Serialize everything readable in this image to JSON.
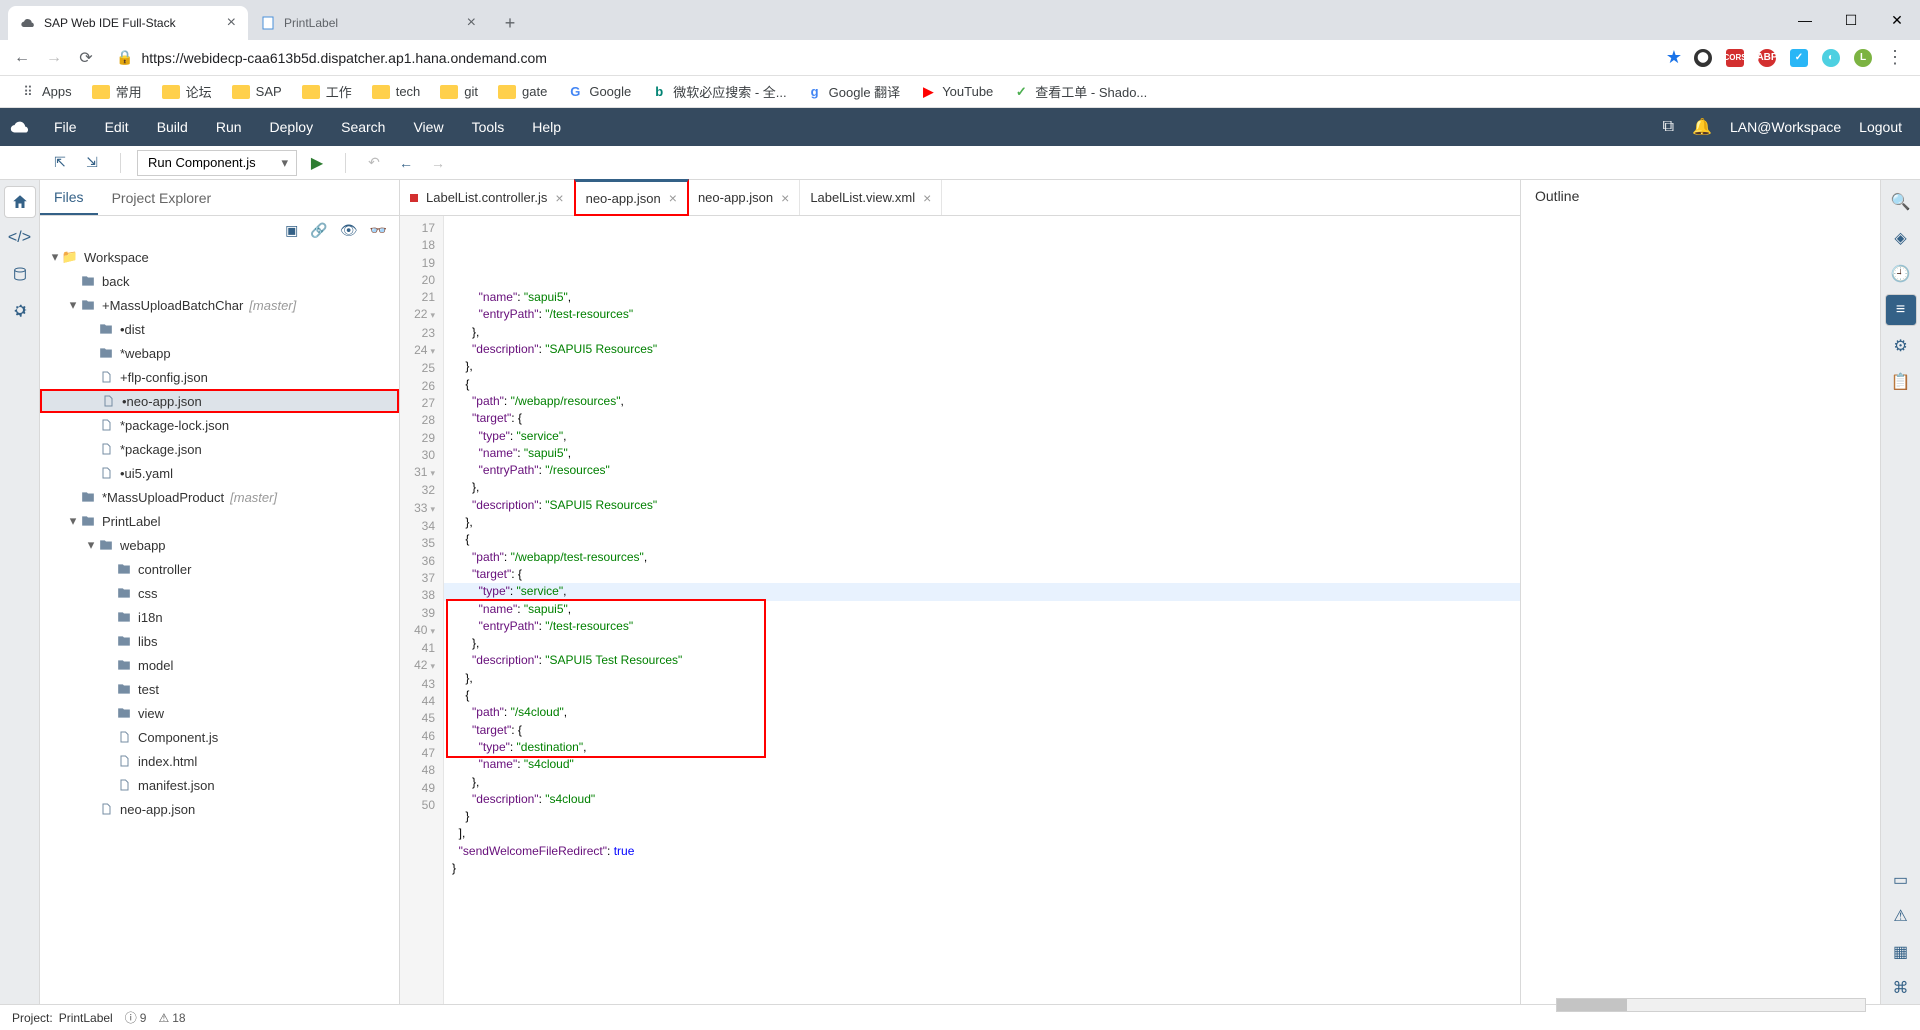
{
  "browser": {
    "tabs": [
      {
        "title": "SAP Web IDE Full-Stack",
        "active": true
      },
      {
        "title": "PrintLabel",
        "active": false
      }
    ],
    "url": "https://webidecp-caa613b5d.dispatcher.ap1.hana.ondemand.com"
  },
  "bookmarks": {
    "apps": "Apps",
    "items": [
      "常用",
      "论坛",
      "SAP",
      "工作",
      "tech",
      "git",
      "gate"
    ],
    "links": [
      {
        "label": "Google",
        "ico": "G"
      },
      {
        "label": "微软必应搜索 - 全...",
        "ico": "b"
      },
      {
        "label": "Google 翻译",
        "ico": "g"
      },
      {
        "label": "YouTube",
        "ico": "▶"
      },
      {
        "label": "查看工单 - Shado...",
        "ico": "✓"
      }
    ]
  },
  "ide": {
    "menu": [
      "File",
      "Edit",
      "Build",
      "Run",
      "Deploy",
      "Search",
      "View",
      "Tools",
      "Help"
    ],
    "user": "LAN@Workspace",
    "logout": "Logout",
    "run_config": "Run Component.js"
  },
  "files": {
    "tabs": {
      "files": "Files",
      "pe": "Project Explorer"
    },
    "workspace": "Workspace",
    "tree": [
      {
        "ind": 1,
        "arrow": "",
        "ico": "fld",
        "label": "back"
      },
      {
        "ind": 1,
        "arrow": "▾",
        "ico": "fld",
        "label": "+MassUploadBatchChar",
        "branch": "[master]"
      },
      {
        "ind": 2,
        "arrow": "",
        "ico": "fld",
        "label": "•dist"
      },
      {
        "ind": 2,
        "arrow": "",
        "ico": "fld",
        "label": "*webapp"
      },
      {
        "ind": 2,
        "arrow": "",
        "ico": "fil",
        "label": "+flp-config.json"
      },
      {
        "ind": 2,
        "arrow": "",
        "ico": "fil",
        "label": "•neo-app.json",
        "selected": true,
        "redbox": true
      },
      {
        "ind": 2,
        "arrow": "",
        "ico": "fil",
        "label": "*package-lock.json"
      },
      {
        "ind": 2,
        "arrow": "",
        "ico": "fil",
        "label": "*package.json"
      },
      {
        "ind": 2,
        "arrow": "",
        "ico": "fil",
        "label": "•ui5.yaml"
      },
      {
        "ind": 1,
        "arrow": "",
        "ico": "fld",
        "label": "*MassUploadProduct",
        "branch": "[master]"
      },
      {
        "ind": 1,
        "arrow": "▾",
        "ico": "fld",
        "label": "PrintLabel"
      },
      {
        "ind": 2,
        "arrow": "▾",
        "ico": "fld",
        "label": "webapp"
      },
      {
        "ind": 3,
        "arrow": "",
        "ico": "fld",
        "label": "controller"
      },
      {
        "ind": 3,
        "arrow": "",
        "ico": "fld",
        "label": "css"
      },
      {
        "ind": 3,
        "arrow": "",
        "ico": "fld",
        "label": "i18n"
      },
      {
        "ind": 3,
        "arrow": "",
        "ico": "fld",
        "label": "libs"
      },
      {
        "ind": 3,
        "arrow": "",
        "ico": "fld",
        "label": "model"
      },
      {
        "ind": 3,
        "arrow": "",
        "ico": "fld",
        "label": "test"
      },
      {
        "ind": 3,
        "arrow": "",
        "ico": "fld",
        "label": "view"
      },
      {
        "ind": 3,
        "arrow": "",
        "ico": "fil",
        "label": "Component.js"
      },
      {
        "ind": 3,
        "arrow": "",
        "ico": "fil",
        "label": "index.html"
      },
      {
        "ind": 3,
        "arrow": "",
        "ico": "fil",
        "label": "manifest.json"
      },
      {
        "ind": 2,
        "arrow": "",
        "ico": "fil",
        "label": "neo-app.json"
      }
    ]
  },
  "editor": {
    "tabs": [
      {
        "label": "LabelList.controller.js",
        "dirty": true,
        "active": false
      },
      {
        "label": "neo-app.json",
        "dirty": false,
        "active": true,
        "redbox": true
      },
      {
        "label": "neo-app.json",
        "dirty": false,
        "active": false
      },
      {
        "label": "LabelList.view.xml",
        "dirty": false,
        "active": false
      }
    ],
    "lines": [
      {
        "n": 17,
        "t": "        \"name\": \"sapui5\","
      },
      {
        "n": 18,
        "t": "        \"entryPath\": \"/test-resources\""
      },
      {
        "n": 19,
        "t": "      },"
      },
      {
        "n": 20,
        "t": "      \"description\": \"SAPUI5 Resources\""
      },
      {
        "n": 21,
        "t": "    },"
      },
      {
        "n": 22,
        "fold": "▾",
        "t": "    {"
      },
      {
        "n": 23,
        "t": "      \"path\": \"/webapp/resources\","
      },
      {
        "n": 24,
        "fold": "▾",
        "t": "      \"target\": {"
      },
      {
        "n": 25,
        "t": "        \"type\": \"service\","
      },
      {
        "n": 26,
        "t": "        \"name\": \"sapui5\","
      },
      {
        "n": 27,
        "t": "        \"entryPath\": \"/resources\""
      },
      {
        "n": 28,
        "t": "      },"
      },
      {
        "n": 29,
        "t": "      \"description\": \"SAPUI5 Resources\""
      },
      {
        "n": 30,
        "t": "    },"
      },
      {
        "n": 31,
        "fold": "▾",
        "t": "    {"
      },
      {
        "n": 32,
        "t": "      \"path\": \"/webapp/test-resources\","
      },
      {
        "n": 33,
        "fold": "▾",
        "t": "      \"target\": {"
      },
      {
        "n": 34,
        "t": "        \"type\": \"service\","
      },
      {
        "n": 35,
        "t": "        \"name\": \"sapui5\","
      },
      {
        "n": 36,
        "t": "        \"entryPath\": \"/test-resources\""
      },
      {
        "n": 37,
        "t": "      },"
      },
      {
        "n": 38,
        "t": "      \"description\": \"SAPUI5 Test Resources\""
      },
      {
        "n": 39,
        "t": "    },"
      },
      {
        "n": 40,
        "fold": "▾",
        "t": "    {"
      },
      {
        "n": 41,
        "t": "      \"path\": \"/s4cloud\","
      },
      {
        "n": 42,
        "fold": "▾",
        "t": "      \"target\": {"
      },
      {
        "n": 43,
        "t": "        \"type\": \"destination\","
      },
      {
        "n": 44,
        "t": "        \"name\": \"s4cloud\""
      },
      {
        "n": 45,
        "t": "      },"
      },
      {
        "n": 46,
        "t": "      \"description\": \"s4cloud\""
      },
      {
        "n": 47,
        "t": "    }"
      },
      {
        "n": 48,
        "t": "  ],"
      },
      {
        "n": 49,
        "t": "  \"sendWelcomeFileRedirect\": true"
      },
      {
        "n": 50,
        "t": "}"
      }
    ],
    "redbox_code": {
      "top_line": 39,
      "bottom_line": 47
    },
    "hl_line": 38
  },
  "outline": {
    "title": "Outline"
  },
  "status": {
    "project_label": "Project:",
    "project": "PrintLabel",
    "errors": "9",
    "warnings": "18"
  }
}
